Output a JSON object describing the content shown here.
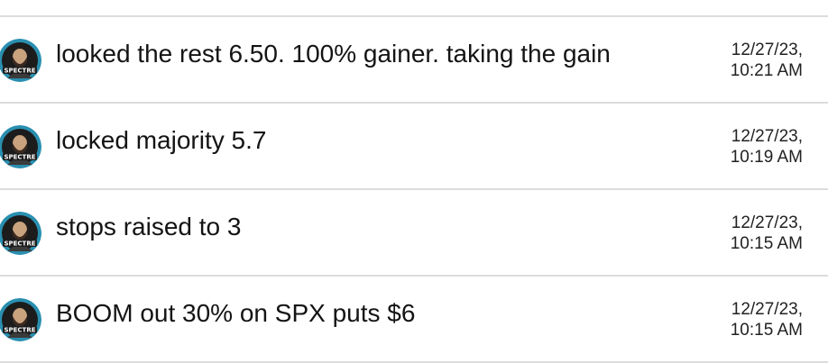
{
  "messages": [
    {
      "avatar_icon": "spectre-avatar-icon",
      "avatar_text": "SPECTRE",
      "text": "looked the rest 6.50. 100% gainer. taking the gain",
      "date": "12/27/23,",
      "time": "10:21 AM"
    },
    {
      "avatar_icon": "spectre-avatar-icon",
      "avatar_text": "SPECTRE",
      "text": "locked majority 5.7",
      "date": "12/27/23,",
      "time": "10:19 AM"
    },
    {
      "avatar_icon": "spectre-avatar-icon",
      "avatar_text": "SPECTRE",
      "text": "stops raised to 3",
      "date": "12/27/23,",
      "time": "10:15 AM"
    },
    {
      "avatar_icon": "spectre-avatar-icon",
      "avatar_text": "SPECTRE",
      "text": "BOOM out 30% on SPX puts $6",
      "date": "12/27/23,",
      "time": "10:15 AM"
    }
  ],
  "colors": {
    "avatar_ring": "#2a8fb0",
    "avatar_bg": "#1c1c1c",
    "divider": "#dcdcdc"
  }
}
